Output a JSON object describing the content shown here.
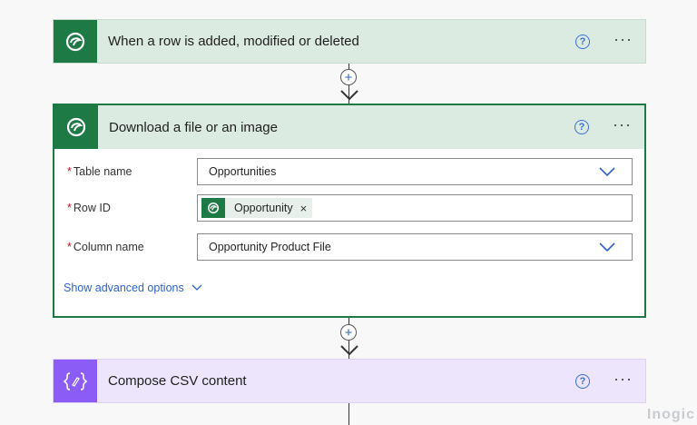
{
  "flow": {
    "trigger": {
      "title": "When a row is added, modified or deleted",
      "icon": "dataverse-icon"
    },
    "download_action": {
      "title": "Download a file or an image",
      "icon": "dataverse-icon",
      "fields": {
        "table_name": {
          "label": "Table name",
          "value": "Opportunities"
        },
        "row_id": {
          "label": "Row ID",
          "token_label": "Opportunity",
          "token_close": "×"
        },
        "column_name": {
          "label": "Column name",
          "value": "Opportunity Product File"
        }
      },
      "required_mark": "*",
      "advanced_link": "Show advanced options"
    },
    "compose_action": {
      "title": "Compose CSV content",
      "icon": "compose-icon"
    },
    "help_symbol": "?",
    "more_symbol": "···"
  },
  "watermark": "Inogic",
  "colors": {
    "dataverse_green": "#1d7a45",
    "compose_purple": "#8b5cf6",
    "link_blue": "#2f63c7"
  }
}
